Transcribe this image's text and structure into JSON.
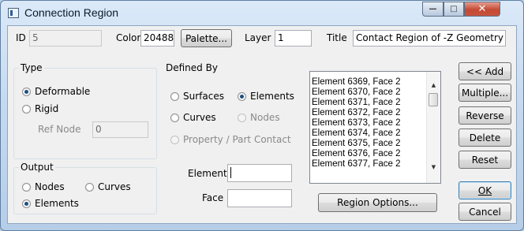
{
  "window": {
    "title": "Connection Region",
    "controls": {
      "minimize": "—",
      "maximize": "□",
      "close": "✕"
    }
  },
  "top_row": {
    "id_label": "ID",
    "id_value": "5",
    "color_label": "Color",
    "color_value": "20488",
    "palette_button": "Palette...",
    "layer_label": "Layer",
    "layer_value": "1",
    "title_label": "Title",
    "title_value": "Contact Region of -Z Geometry"
  },
  "type_group": {
    "title": "Type",
    "options": [
      "Deformable",
      "Rigid"
    ],
    "selected": "Deformable",
    "ref_node_label": "Ref Node",
    "ref_node_value": "0"
  },
  "output_group": {
    "title": "Output",
    "options": [
      "Nodes",
      "Curves",
      "Elements"
    ],
    "selected": "Elements"
  },
  "defined_by": {
    "title": "Defined By",
    "options": [
      "Surfaces",
      "Elements",
      "Curves",
      "Nodes",
      "Property / Part Contact"
    ],
    "selected": "Elements",
    "element_label": "Element",
    "element_value": "",
    "face_label": "Face",
    "face_value": ""
  },
  "entity_list": {
    "items": [
      "Element 6369, Face 2",
      "Element 6370, Face 2",
      "Element 6371, Face 2",
      "Element 6372, Face 2",
      "Element 6373, Face 2",
      "Element 6374, Face 2",
      "Element 6375, Face 2",
      "Element 6376, Face 2",
      "Element 6377, Face 2"
    ],
    "scroll_up": "▲",
    "scroll_down": "▼"
  },
  "region_options_button": "Region Options...",
  "side_buttons": {
    "add": "<< Add",
    "multiple": "Multiple...",
    "reverse": "Reverse",
    "delete": "Delete",
    "reset": "Reset",
    "ok": "OK",
    "cancel": "Cancel"
  }
}
